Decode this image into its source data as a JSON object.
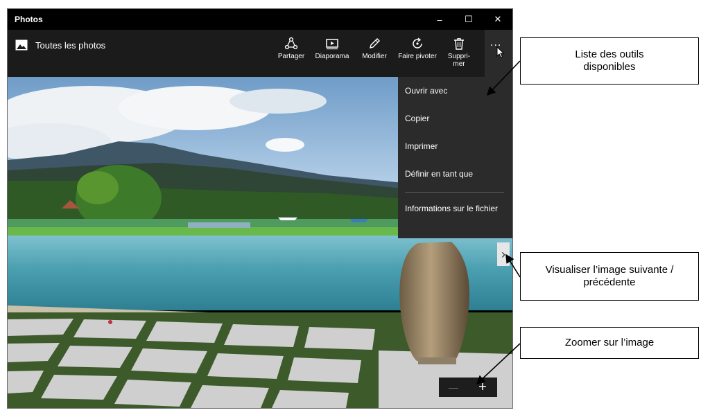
{
  "window": {
    "title": "Photos",
    "minimize_glyph": "–",
    "maximize_glyph": "☐",
    "close_glyph": "✕"
  },
  "toolbar": {
    "album_label": "Toutes les photos",
    "buttons": [
      {
        "label": "Partager",
        "icon": "share-icon"
      },
      {
        "label": "Diaporama",
        "icon": "slideshow-icon"
      },
      {
        "label": "Modifier",
        "icon": "pencil-icon"
      },
      {
        "label": "Faire pivoter",
        "icon": "rotate-icon"
      },
      {
        "label": "Suppri-\nmer",
        "icon": "trash-icon"
      }
    ],
    "more_label": "..."
  },
  "menu": {
    "items": [
      "Ouvrir avec",
      "Copier",
      "Imprimer",
      "Définir en tant que",
      "Informations sur le fichier"
    ]
  },
  "navigation": {
    "next_glyph": "›"
  },
  "zoom": {
    "minus_glyph": "—",
    "plus_glyph": "+"
  },
  "callouts": {
    "tools": "Liste des outils disponibles",
    "navigate": "Visualiser l’image suivante / précédente",
    "zoom": "Zoomer sur l’image"
  },
  "colors": {
    "titlebar": "#000000",
    "toolbar": "#1b1b1b",
    "menu": "#2b2b2b",
    "water": "#4a9fb0"
  }
}
